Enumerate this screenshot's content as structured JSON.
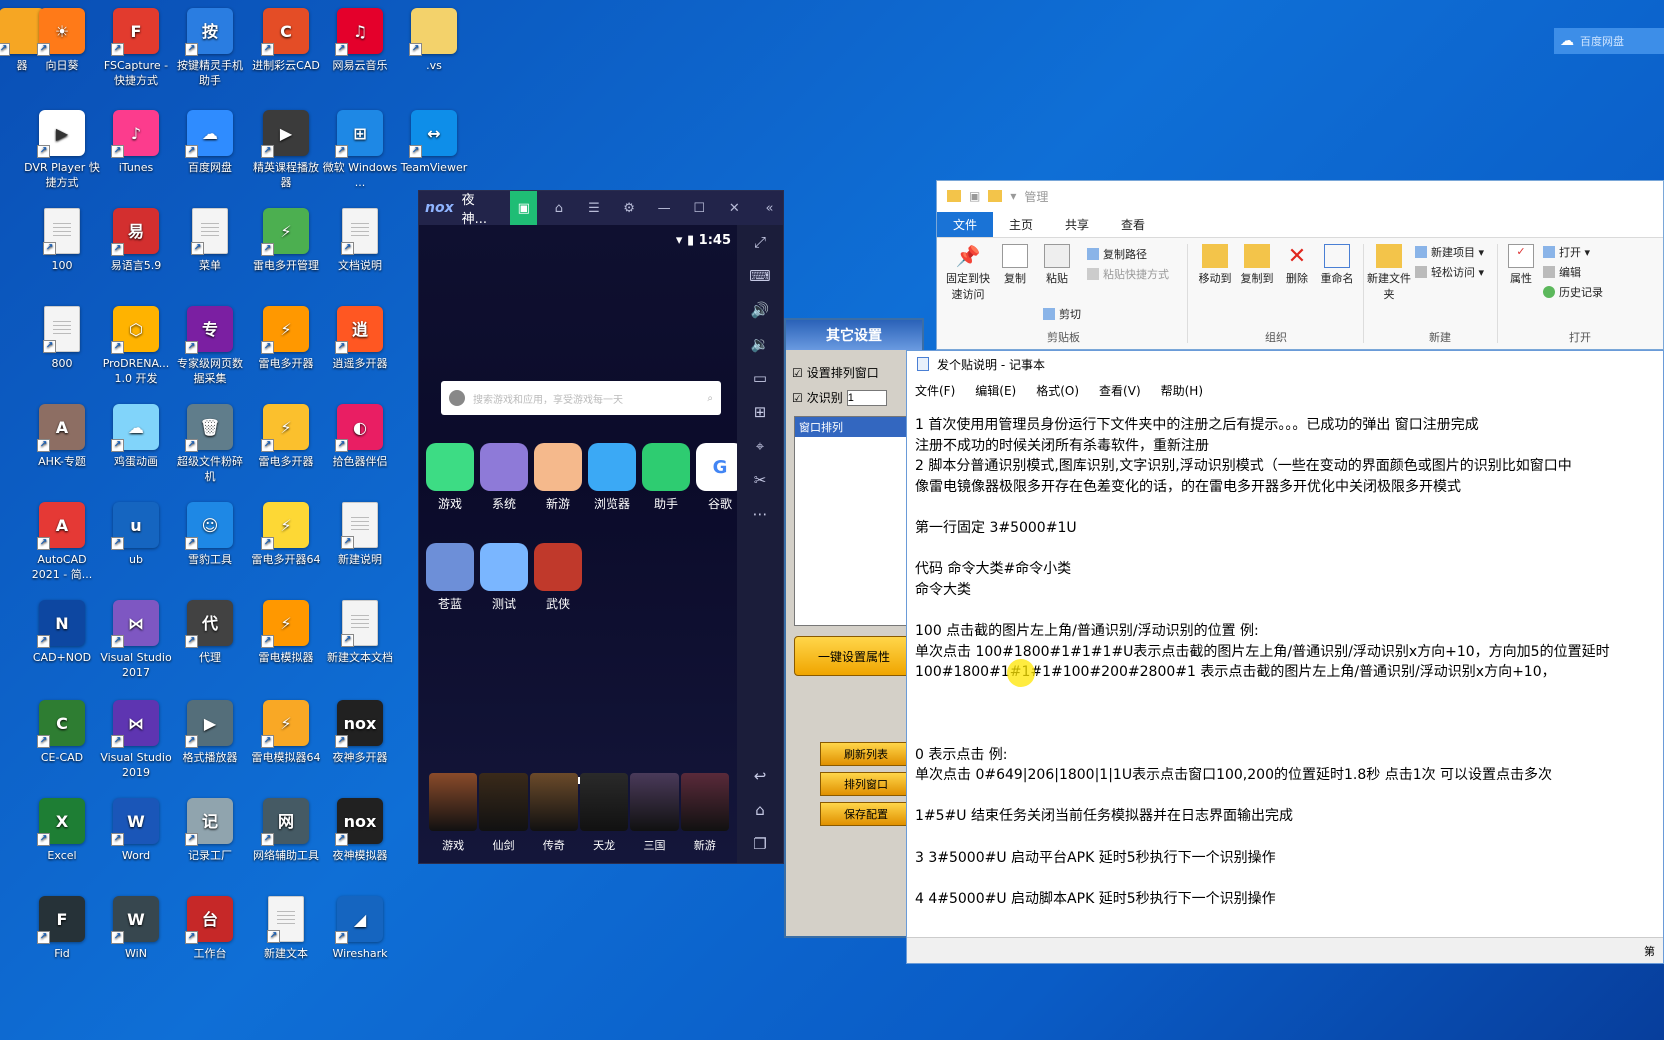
{
  "desktop": {
    "icons": [
      {
        "label": "器",
        "color": "#f6a623",
        "glyph": ""
      },
      {
        "label": "向日葵",
        "color": "#ff7a18",
        "glyph": "☀"
      },
      {
        "label": "FSCapture - 快捷方式",
        "color": "#e23b2e",
        "glyph": "F"
      },
      {
        "label": "按键精灵手机助手",
        "color": "#2a7de1",
        "glyph": "按"
      },
      {
        "label": "进制彩云CAD",
        "color": "#e44d26",
        "glyph": "C"
      },
      {
        "label": "网易云音乐",
        "color": "#e4002b",
        "glyph": "♫"
      },
      {
        "label": ".vs",
        "color": "#f3d26b",
        "glyph": ""
      },
      {
        "label": "DVR Player 快捷方式",
        "color": "#ffffff",
        "glyph": "▶"
      },
      {
        "label": "iTunes",
        "color": "#fc3c8d",
        "glyph": "♪"
      },
      {
        "label": "百度网盘",
        "color": "#2f8cff",
        "glyph": "☁"
      },
      {
        "label": "精英课程播放器",
        "color": "#3b3b3b",
        "glyph": "▶"
      },
      {
        "label": "微软 Windows ...",
        "color": "#1e88e5",
        "glyph": "⊞"
      },
      {
        "label": "TeamViewer",
        "color": "#0e8ee9",
        "glyph": "↔"
      },
      {
        "label": "100",
        "doc": true
      },
      {
        "label": "易语言5.9",
        "color": "#d32f2f",
        "glyph": "易"
      },
      {
        "label": "菜单",
        "doc": true
      },
      {
        "label": "雷电多开管理",
        "color": "#4caf50",
        "glyph": "⚡"
      },
      {
        "label": "文档说明",
        "doc": true
      },
      {
        "label": "800",
        "doc": true
      },
      {
        "label": "ProDRENA... 1.0 开发",
        "color": "#ffb300",
        "glyph": "⬡"
      },
      {
        "label": "专家级网页数据采集",
        "color": "#7b1fa2",
        "glyph": "专"
      },
      {
        "label": "雷电多开器",
        "color": "#ff9800",
        "glyph": "⚡"
      },
      {
        "label": "逍遥多开器",
        "color": "#ff5722",
        "glyph": "逍"
      },
      {
        "label": "AHK-专题",
        "color": "#8d6e63",
        "glyph": "A"
      },
      {
        "label": "鸡蛋动画",
        "color": "#81d4fa",
        "glyph": "☁"
      },
      {
        "label": "超级文件粉碎机",
        "color": "#607d8b",
        "glyph": "🗑"
      },
      {
        "label": "雷电多开器",
        "color": "#fbc02d",
        "glyph": "⚡"
      },
      {
        "label": "拾色器伴侣",
        "color": "#e91e63",
        "glyph": "◐"
      },
      {
        "label": "AutoCAD 2021 - 简...",
        "color": "#e53935",
        "glyph": "A"
      },
      {
        "label": "ub",
        "color": "#1565c0",
        "glyph": "u"
      },
      {
        "label": "雪豹工具",
        "color": "#1e88e5",
        "glyph": "☺"
      },
      {
        "label": "雷电多开器64",
        "color": "#fdd835",
        "glyph": "⚡"
      },
      {
        "label": "新建说明",
        "doc": true
      },
      {
        "label": "CAD+NOD",
        "color": "#0d47a1",
        "glyph": "N"
      },
      {
        "label": "Visual Studio 2017",
        "color": "#7e57c2",
        "glyph": "⋈"
      },
      {
        "label": "代理",
        "color": "#424242",
        "glyph": "代"
      },
      {
        "label": "雷电模拟器",
        "color": "#ff9800",
        "glyph": "⚡"
      },
      {
        "label": "新建文本文档",
        "doc": true
      },
      {
        "label": "CE-CAD",
        "color": "#2e7d32",
        "glyph": "C"
      },
      {
        "label": "Visual Studio 2019",
        "color": "#5e35b1",
        "glyph": "⋈"
      },
      {
        "label": "格式播放器",
        "color": "#546e7a",
        "glyph": "▶"
      },
      {
        "label": "雷电模拟器64",
        "color": "#f9a825",
        "glyph": "⚡"
      },
      {
        "label": "夜神多开器",
        "color": "#212121",
        "glyph": "nox"
      },
      {
        "label": "Excel",
        "color": "#1e7e34",
        "glyph": "X"
      },
      {
        "label": "Word",
        "color": "#1a56b8",
        "glyph": "W"
      },
      {
        "label": "记录工厂",
        "color": "#90a4ae",
        "glyph": "记"
      },
      {
        "label": "网络辅助工具",
        "color": "#455a64",
        "glyph": "网"
      },
      {
        "label": "夜神模拟器",
        "color": "#212121",
        "glyph": "nox"
      },
      {
        "label": "Fid",
        "color": "#263238",
        "glyph": "F"
      },
      {
        "label": "WiN",
        "color": "#37474f",
        "glyph": "W"
      },
      {
        "label": "工作台",
        "color": "#c62828",
        "glyph": "台"
      },
      {
        "label": "新建文本",
        "doc": true
      },
      {
        "label": "Wireshark",
        "color": "#1565c0",
        "glyph": "◢"
      }
    ]
  },
  "nox": {
    "title": "夜神...",
    "logo": "nox",
    "time": "1:45",
    "search_placeholder": "搜索游戏和应用，享受游戏每一天",
    "apps_row1": [
      {
        "label": "游戏",
        "color": "#3ddc84"
      },
      {
        "label": "系统",
        "color": "#8e7ad8"
      },
      {
        "label": "新游",
        "color": "#f5b98c"
      },
      {
        "label": "浏览器",
        "color": "#3ba9f5"
      },
      {
        "label": "助手",
        "color": "#2ecc71"
      },
      {
        "label": "谷歌",
        "color": "#ffffff"
      }
    ],
    "apps_row2": [
      {
        "label": "苍蓝",
        "color": "#6d8fd8"
      },
      {
        "label": "测试",
        "color": "#7ab6ff"
      },
      {
        "label": "武侠",
        "color": "#c0392b"
      }
    ],
    "games": [
      "游戏",
      "仙剑",
      "传奇",
      "天龙",
      "三国",
      "新游"
    ]
  },
  "settings": {
    "title": "其它设置",
    "check1": "设置排列窗口",
    "check2": "次识别",
    "count_value": "1",
    "list_header": "窗口排列",
    "apply_button": "一键设置属性",
    "side_buttons": [
      "刷新列表",
      "排列窗口",
      "保存配置"
    ]
  },
  "explorer": {
    "title": "管理",
    "tabs": [
      "文件",
      "主页",
      "共享",
      "查看"
    ],
    "pin": "固定到快速访问",
    "copy": "复制",
    "paste": "粘贴",
    "copy_path": "复制路径",
    "paste_shortcut": "粘贴快捷方式",
    "cut": "剪切",
    "move_to": "移动到",
    "copy_to": "复制到",
    "delete": "删除",
    "rename": "重命名",
    "new_folder": "新建文件夹",
    "new_item": "新建项目 ▾",
    "easy_access": "轻松访问 ▾",
    "properties": "属性",
    "open": "打开 ▾",
    "edit": "编辑",
    "history": "历史记录",
    "groups": [
      "剪贴板",
      "组织",
      "新建",
      "打开"
    ]
  },
  "notepad": {
    "title": "发个贴说明 - 记事本",
    "menu": [
      "文件(F)",
      "编辑(E)",
      "格式(O)",
      "查看(V)",
      "帮助(H)"
    ],
    "lines": [
      "1    首次使用用管理员身份运行下文件夹中的注册之后有提示。。。已成功的弹出 窗口注册完成",
      "      注册不成功的时候关闭所有杀毒软件，重新注册",
      "2    脚本分普通识别模式,图库识别,文字识别,浮动识别模式（一些在变动的界面颜色或图片的识别比如窗口中",
      "      像雷电镜像器极限多开存在色差变化的话，的在雷电多开器多开优化中关闭极限多开模式",
      "",
      "第一行固定 3#5000#1U",
      "",
      "代码 命令大类#命令小类",
      "命令大类",
      "",
      "100 点击截的图片左上角/普通识别/浮动识别的位置        例:",
      "单次点击  100#1800#1#1#1#U表示点击截的图片左上角/普通识别/浮动识别x方向+10，方向加5的位置延时",
      "                100#1800#1#1#1#100#200#2800#1  表示点击截的图片左上角/普通识别/浮动识别x方向+10，",
      "",
      "",
      "",
      "0 表示点击 例:",
      "单次点击  0#649|206|1800|1|1U表示点击窗口100,200的位置延时1.8秒 点击1次 可以设置点击多次",
      "",
      "1#5#U 结束任务关闭当前任务模拟器并在日志界面输出完成",
      "",
      "3   3#5000#U 启动平台APK 延时5秒执行下一个识别操作",
      "",
      "4   4#5000#U 启动脚本APK 延时5秒执行下一个识别操作"
    ],
    "status": "第"
  },
  "tray": {
    "label": "百度网盘"
  }
}
